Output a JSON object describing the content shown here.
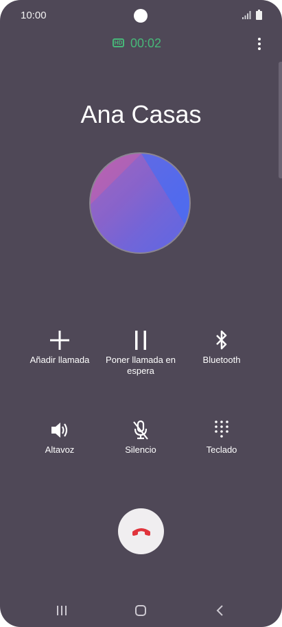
{
  "status_bar": {
    "time": "10:00",
    "icons": [
      "camera-cutout",
      "signal-icon",
      "battery-icon"
    ]
  },
  "call": {
    "hd_label": "HD",
    "duration": "00:02",
    "caller_name": "Ana Casas",
    "colors": {
      "accent_green": "#47b879",
      "background": "#4f4857",
      "end_call_red": "#e0343c"
    }
  },
  "actions": [
    {
      "label": "Añadir llamada",
      "icon": "plus-icon"
    },
    {
      "label": "Poner llamada en espera",
      "icon": "pause-icon"
    },
    {
      "label": "Bluetooth",
      "icon": "bluetooth-icon"
    },
    {
      "label": "Altavoz",
      "icon": "speaker-icon"
    },
    {
      "label": "Silencio",
      "icon": "mic-off-icon"
    },
    {
      "label": "Teclado",
      "icon": "keypad-icon"
    }
  ],
  "end_call": {
    "icon": "end-call-icon"
  },
  "nav": {
    "icons": [
      "recents-icon",
      "home-icon",
      "back-icon"
    ]
  }
}
